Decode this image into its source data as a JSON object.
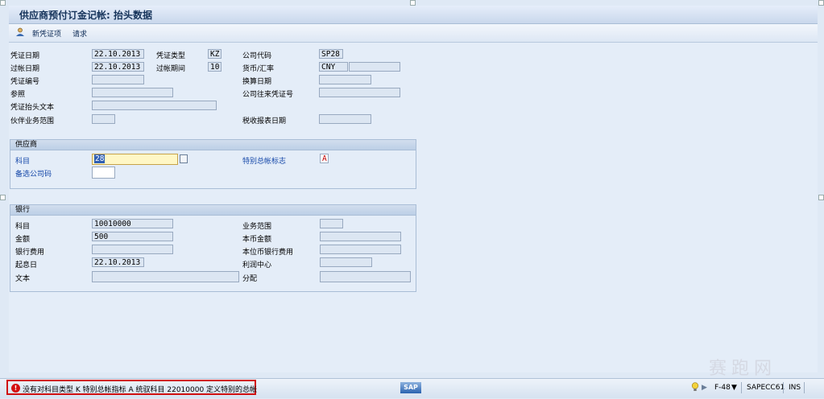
{
  "window": {
    "title": "供应商预付订金记帐: 抬头数据"
  },
  "toolbar": {
    "new_item": "新凭证项",
    "request": "请求"
  },
  "header": {
    "doc_date_label": "凭证日期",
    "doc_date": "22.10.2013",
    "doc_type_label": "凭证类型",
    "doc_type": "KZ",
    "company_code_label": "公司代码",
    "company_code": "SP28",
    "posting_date_label": "过帐日期",
    "posting_date": "22.10.2013",
    "period_label": "过帐期间",
    "period": "10",
    "currency_label": "货币/汇率",
    "currency": "CNY",
    "doc_number_label": "凭证编号",
    "translation_date_label": "换算日期",
    "reference_label": "参照",
    "intercompany_label": "公司往来凭证号",
    "header_text_label": "凭证抬头文本",
    "partner_ba_label": "伙伴业务范围",
    "tax_date_label": "税收报表日期"
  },
  "vendor": {
    "title": "供应商",
    "account_label": "科目",
    "account": "28",
    "sgl_label": "特别总帐标志",
    "sgl": "A",
    "alt_cc_label": "备选公司码"
  },
  "bank": {
    "title": "银行",
    "account_label": "科目",
    "account": "10010000",
    "business_area_label": "业务范围",
    "amount_label": "金额",
    "amount": "500",
    "local_amount_label": "本币金额",
    "bank_charges_label": "银行费用",
    "local_bank_charges_label": "本位币银行费用",
    "value_date_label": "起息日",
    "value_date": "22.10.2013",
    "profit_center_label": "利润中心",
    "text_label": "文本",
    "assignment_label": "分配"
  },
  "status": {
    "message": "没有对科目类型 K 特别总帐指标 A 统驭科目 22010000 定义特别的总帐",
    "sap_logo": "SAP",
    "transaction": "F-48",
    "system": "SAPECC61",
    "mode": "INS"
  },
  "watermark": "赛跑网",
  "colors": {
    "error": "#d01010",
    "label_blue": "#1447a8",
    "edit_field": "#fff7c6"
  }
}
